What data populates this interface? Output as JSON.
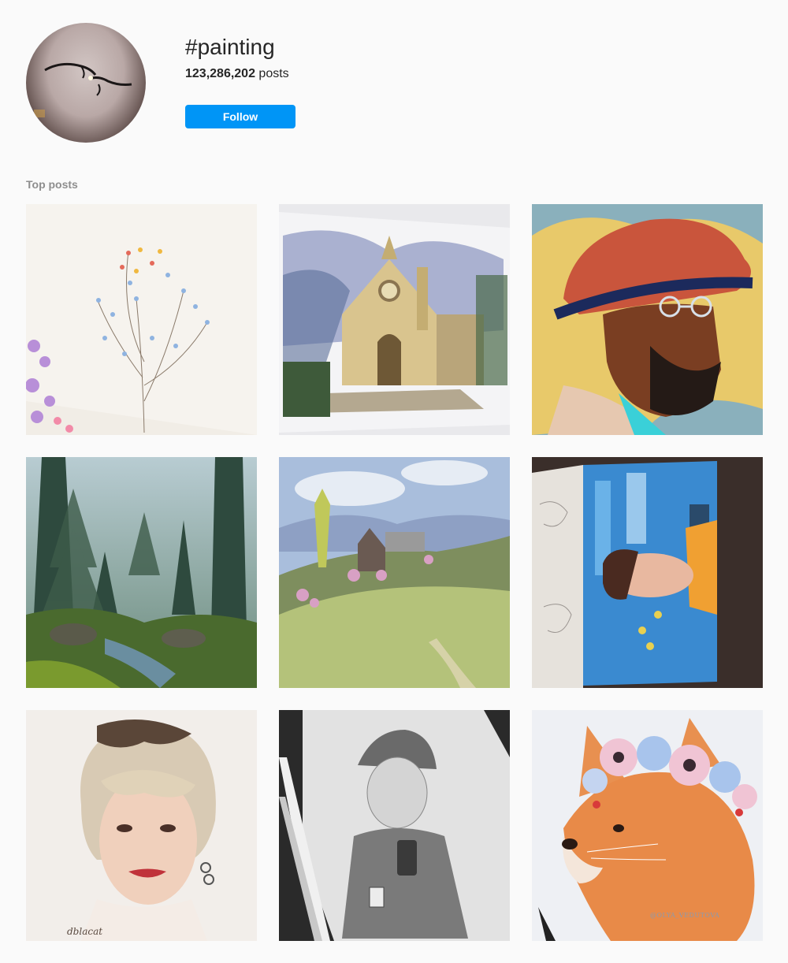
{
  "header": {
    "hashtag": "#painting",
    "post_count": "123,286,202",
    "post_count_suffix": " posts",
    "follow_label": "Follow"
  },
  "section": {
    "title": "Top posts"
  },
  "posts": [
    {
      "subject": "wildflower watercolor"
    },
    {
      "subject": "church watercolor"
    },
    {
      "subject": "man in red hat portrait"
    },
    {
      "subject": "misty forest painting"
    },
    {
      "subject": "hillside cottage landscape"
    },
    {
      "subject": "sketchbook portrait"
    },
    {
      "subject": "blonde portrait drawing",
      "signature": "dblacat"
    },
    {
      "subject": "pencil portrait in beanie"
    },
    {
      "subject": "fox with flower crown",
      "watermark": "@OLYA_VEDUTOVA"
    }
  ],
  "colors": {
    "follow_button": "#0095f6",
    "background": "#fafafa",
    "muted_text": "#8e8e8e"
  }
}
